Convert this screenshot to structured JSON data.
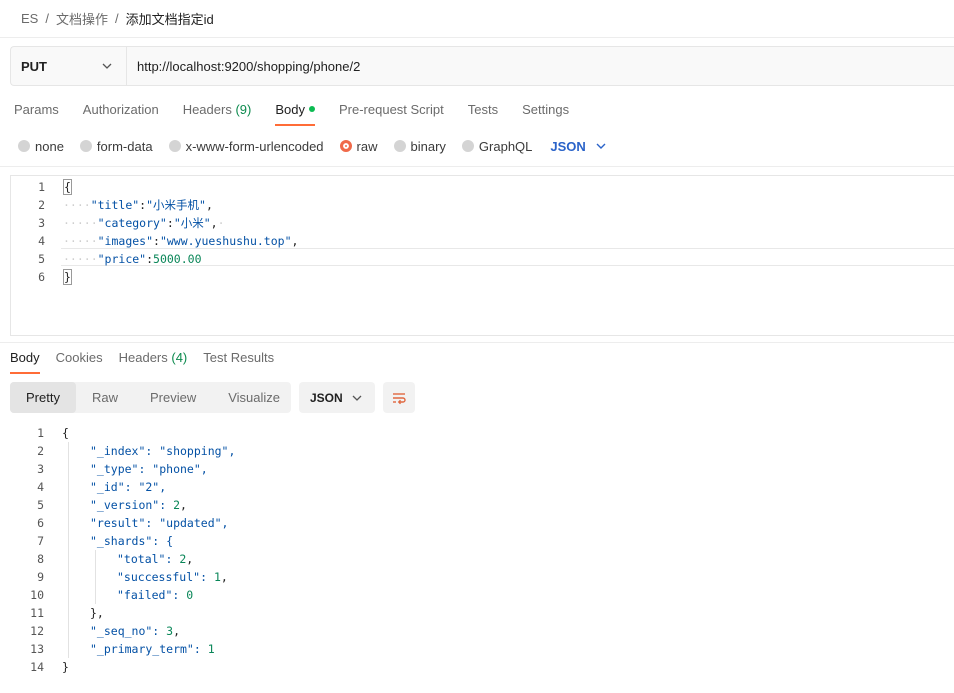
{
  "breadcrumb": {
    "items": [
      "ES",
      "文档操作"
    ],
    "current": "添加文档指定id"
  },
  "request": {
    "method": "PUT",
    "url": "http://localhost:9200/shopping/phone/2"
  },
  "request_tabs": [
    {
      "label": "Params"
    },
    {
      "label": "Authorization"
    },
    {
      "label": "Headers",
      "count": "(9)"
    },
    {
      "label": "Body",
      "active": true
    },
    {
      "label": "Pre-request Script"
    },
    {
      "label": "Tests"
    },
    {
      "label": "Settings"
    }
  ],
  "body_types": {
    "options": [
      "none",
      "form-data",
      "x-www-form-urlencoded",
      "raw",
      "binary",
      "GraphQL"
    ],
    "selected": "raw",
    "format": "JSON"
  },
  "request_body": {
    "line_numbers": [
      "1",
      "2",
      "3",
      "4",
      "5",
      "6"
    ],
    "lines": [
      {
        "open": "{"
      },
      {
        "key": "\"title\"",
        "sep": ":",
        "value": "\"小米手机\"",
        "tail": ","
      },
      {
        "key": "\"category\"",
        "sep": ":",
        "value": "\"小米\"",
        "tail": ","
      },
      {
        "key": "\"images\"",
        "sep": ":",
        "value": "\"www.yueshushu.top\"",
        "tail": ","
      },
      {
        "key": "\"price\"",
        "sep": ":",
        "value": "5000.00",
        "tail": ""
      },
      {
        "close": "}"
      }
    ]
  },
  "response_tabs": [
    {
      "label": "Body",
      "active": true
    },
    {
      "label": "Cookies"
    },
    {
      "label": "Headers",
      "count": "(4)"
    },
    {
      "label": "Test Results"
    }
  ],
  "response_view": {
    "modes": [
      "Pretty",
      "Raw",
      "Preview",
      "Visualize"
    ],
    "active_mode": "Pretty",
    "format": "JSON",
    "wrap_icon": "wrap-lines-icon"
  },
  "response_body": {
    "line_numbers": [
      "1",
      "2",
      "3",
      "4",
      "5",
      "6",
      "7",
      "8",
      "9",
      "10",
      "11",
      "12",
      "13",
      "14"
    ],
    "lines": [
      "{",
      "\"_index\": \"shopping\",",
      "\"_type\": \"phone\",",
      "\"_id\": \"2\",",
      "\"_version\": 2,",
      "\"result\": \"updated\",",
      "\"_shards\": {",
      "\"total\": 2,",
      "\"successful\": 1,",
      "\"failed\": 0",
      "},",
      "\"_seq_no\": 3,",
      "\"_primary_term\": 1",
      "}"
    ]
  },
  "colors": {
    "accent": "#ff6c37",
    "json_key": "#0451a5",
    "json_number": "#098658",
    "link_blue": "#2a63c9",
    "status_green": "#0cbb52"
  }
}
